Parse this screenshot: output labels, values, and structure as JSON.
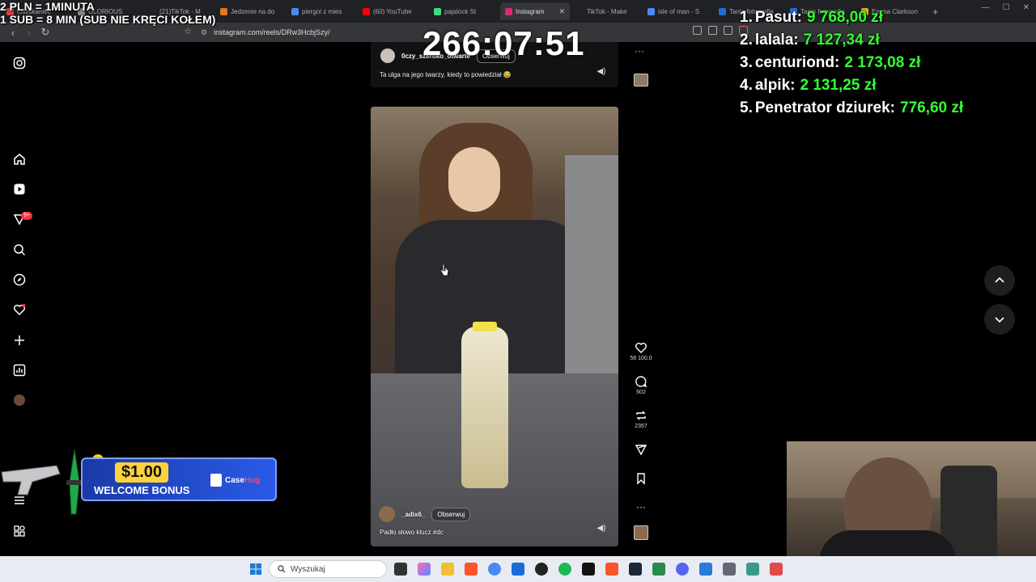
{
  "browser": {
    "tabs": [
      {
        "label": "Oszukaniec",
        "color": "#e04040"
      },
      {
        "label": "GLORIOUS",
        "color": "#888888"
      },
      {
        "label": "(21)TikTok - M",
        "color": "#222222"
      },
      {
        "label": "Jedzenie na do",
        "color": "#e07a20"
      },
      {
        "label": "piergoi z mies",
        "color": "#4a8af4"
      },
      {
        "label": "(60) YouTube",
        "color": "#ff0000"
      },
      {
        "label": "pajalock St",
        "color": "#3ddc84"
      },
      {
        "label": "Instagram",
        "color": "#d62976",
        "active": true
      },
      {
        "label": "TikTok - Make",
        "color": "#222222"
      },
      {
        "label": "isle of man - S",
        "color": "#4a8af4"
      },
      {
        "label": "Tania fotografia",
        "color": "#1e6fd9"
      },
      {
        "label": "Tania fotografia",
        "color": "#1e6fd9"
      },
      {
        "label": "Emma Clarkson",
        "color": "#e0b020"
      }
    ],
    "new_tab": "+",
    "url": "instagram.com/reels/DRw3HcbjSzy/"
  },
  "overlay": {
    "rate_line1": "2 PLN = 1MINUTA",
    "rate_line2": "1 SUB = 8 MIN (SUB NIE KRĘCI KOŁEM)",
    "timer": "266:07:51",
    "leaderboard": [
      {
        "rank": "1.",
        "name": "Pasut:",
        "amount": "9 768,00 zł"
      },
      {
        "rank": "2.",
        "name": "lalala:",
        "amount": "7 127,34 zł"
      },
      {
        "rank": "3.",
        "name": "centuriond:",
        "amount": "2 173,08 zł"
      },
      {
        "rank": "4.",
        "name": "alpik:",
        "amount": "2 131,25 zł"
      },
      {
        "rank": "5.",
        "name": "Penetrator dziurek:",
        "amount": "776,60 zł"
      }
    ]
  },
  "instagram": {
    "notif_badge": "9+",
    "prev_post": {
      "username": "0czy_szeroko_otwarte",
      "follow": "Obserwuj",
      "caption": "Ta ulga na jego twarzy, kiedy to powiedział 😂"
    },
    "post": {
      "username": "_adix6_",
      "follow": "Obserwuj",
      "caption": "Padło słowo klucz #dc"
    },
    "actions": {
      "likes": "58 100,0",
      "comments": "502",
      "reposts": "2357"
    }
  },
  "promo": {
    "amount": "$1.00",
    "text": "WELCOME BONUS",
    "brand_a": "Case",
    "brand_b": "Hug"
  },
  "taskbar": {
    "search_placeholder": "Wyszukaj"
  }
}
